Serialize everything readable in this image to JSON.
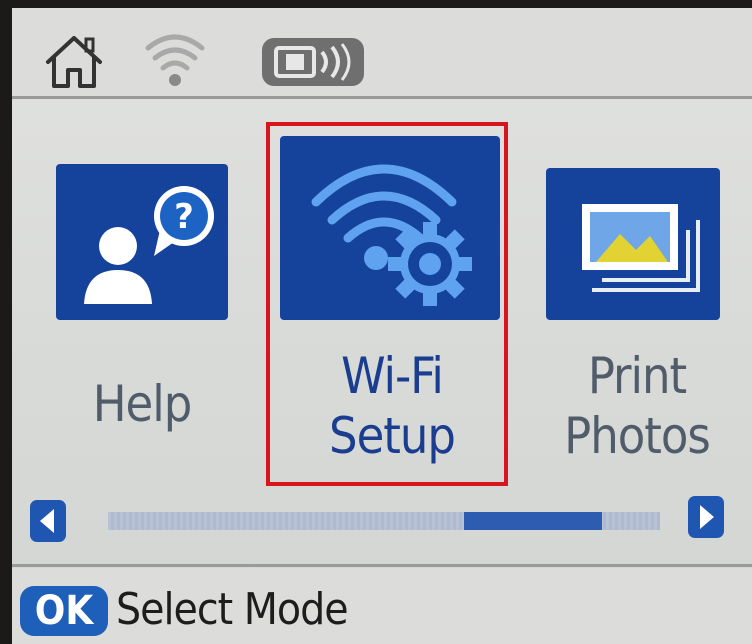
{
  "status_bar": {
    "icons": [
      "home-icon",
      "wifi-signal-icon",
      "nfc-icon"
    ]
  },
  "menu": {
    "items": [
      {
        "id": "help",
        "icon": "help-person-icon",
        "lines": [
          "Help"
        ],
        "selected": false
      },
      {
        "id": "wifi-setup",
        "icon": "wifi-gear-icon",
        "lines": [
          "Wi-Fi",
          "Setup"
        ],
        "selected": true
      },
      {
        "id": "print-photos",
        "icon": "photos-icon",
        "lines": [
          "Print",
          "Photos"
        ],
        "selected": false
      }
    ]
  },
  "scrollbar": {
    "left_icon": "scroll-left-icon",
    "right_icon": "scroll-right-icon",
    "position_fraction": 0.86,
    "thumb_fraction": 0.25
  },
  "footer": {
    "button_label": "OK",
    "hint": "Select Mode"
  },
  "colors": {
    "tile": "#15439b",
    "selection": "#d7151c",
    "accent": "#1e5fb9"
  }
}
